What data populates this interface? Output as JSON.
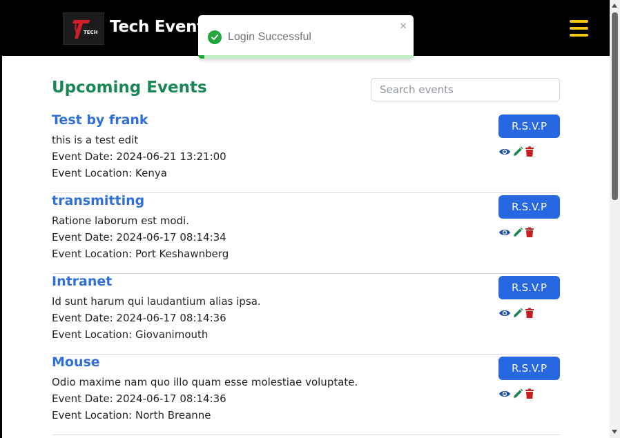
{
  "navbar": {
    "brand": "Tech Events",
    "logo_text": "TECH"
  },
  "toast": {
    "message": "Login Successful",
    "close_glyph": "×",
    "progress_fraction": 0.03
  },
  "page": {
    "title": "Upcoming Events"
  },
  "search": {
    "placeholder": "Search events",
    "value": ""
  },
  "events": [
    {
      "title": "Test by frank",
      "description": "this is a test edit",
      "date": "Event Date: 2024-06-21 13:21:00",
      "location": "Event Location: Kenya",
      "rsvp_label": "R.S.V.P"
    },
    {
      "title": "transmitting",
      "description": "Ratione laborum est modi.",
      "date": "Event Date: 2024-06-17 08:14:34",
      "location": "Event Location: Port Keshawnberg",
      "rsvp_label": "R.S.V.P"
    },
    {
      "title": "Intranet",
      "description": "Id sunt harum qui laudantium alias ipsa.",
      "date": "Event Date: 2024-06-17 08:14:36",
      "location": "Event Location: Giovanimouth",
      "rsvp_label": "R.S.V.P"
    },
    {
      "title": "Mouse",
      "description": "Odio maxime nam quo illo quam esse molestiae voluptate.",
      "date": "Event Date: 2024-06-17 08:14:36",
      "location": "Event Location: North Breanne",
      "rsvp_label": "R.S.V.P"
    }
  ],
  "icons": {
    "view": "eye-icon",
    "edit": "pencil-icon",
    "delete": "trash-icon",
    "menu": "hamburger-menu-icon",
    "toast_status": "check-circle-icon"
  },
  "colors": {
    "title_green": "#198754",
    "link_blue": "#2f6fd6",
    "button_blue": "#2867e2",
    "toast_green": "#22a73c",
    "hamburger_yellow": "#f5c518",
    "view_icon": "#1f4fa8",
    "edit_icon": "#198754",
    "delete_icon": "#c81e1e"
  }
}
